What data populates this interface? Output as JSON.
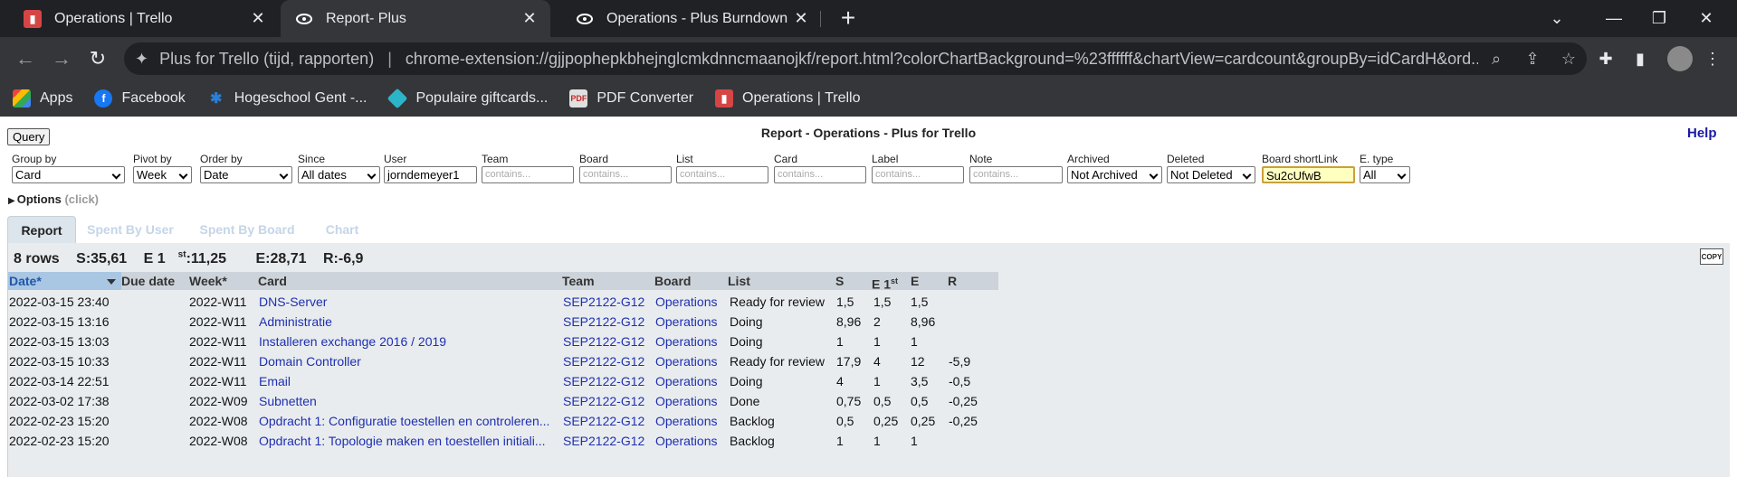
{
  "browser": {
    "tabs": [
      {
        "title": "Operations | Trello",
        "icon": "trello-icon",
        "active": false
      },
      {
        "title": "Report- Plus",
        "icon": "plus-for-trello-icon",
        "active": true
      },
      {
        "title": "Operations - Plus Burndown",
        "icon": "plus-for-trello-icon",
        "active": false
      }
    ],
    "address": {
      "site": "Plus for Trello (tijd, rapporten)",
      "separator": "|",
      "path": "chrome-extension://gjjpophepkbhejnglcmkdnncmaanojkf/report.html?colorChartBackground=%23ffffff&chartView=cardcount&groupBy=idCardH&ord..."
    },
    "bookmarks": [
      {
        "label": "Apps",
        "icon": "apps-grid-icon",
        "color": "#e8453c"
      },
      {
        "label": "Facebook",
        "icon": "facebook-icon",
        "color": "#1877f2"
      },
      {
        "label": "Hogeschool Gent -...",
        "icon": "hogent-icon",
        "color": "#2a7fd4"
      },
      {
        "label": "Populaire giftcards...",
        "icon": "giftcard-icon",
        "color": "#2bb5c8"
      },
      {
        "label": "PDF Converter",
        "icon": "pdf-icon",
        "color": "#e0e0e0"
      },
      {
        "label": "Operations | Trello",
        "icon": "trello-icon",
        "color": "#d64545"
      }
    ]
  },
  "report": {
    "query_label": "Query",
    "title": "Report - Operations - Plus for Trello",
    "help_label": "Help",
    "filters": {
      "group_by": {
        "label": "Group by",
        "value": "Card"
      },
      "pivot_by": {
        "label": "Pivot by",
        "value": "Week"
      },
      "order_by": {
        "label": "Order by",
        "value": "Date"
      },
      "since": {
        "label": "Since",
        "value": "All dates"
      },
      "user": {
        "label": "User",
        "value": "jorndemeyer1"
      },
      "team": {
        "label": "Team",
        "placeholder": "contains..."
      },
      "board": {
        "label": "Board",
        "placeholder": "contains..."
      },
      "list": {
        "label": "List",
        "placeholder": "contains..."
      },
      "card": {
        "label": "Card",
        "placeholder": "contains..."
      },
      "label": {
        "label": "Label",
        "placeholder": "contains..."
      },
      "note": {
        "label": "Note",
        "placeholder": "contains..."
      },
      "archived": {
        "label": "Archived",
        "value": "Not Archived"
      },
      "deleted": {
        "label": "Deleted",
        "value": "Not Deleted"
      },
      "board_shortlink": {
        "label": "Board shortLink",
        "value": "Su2cUfwB"
      },
      "e_type": {
        "label": "E. type",
        "value": "All"
      }
    },
    "options": {
      "label": "Options",
      "hint": "(click)"
    },
    "tabs": [
      "Report",
      "Spent By User",
      "Spent By Board",
      "Chart"
    ],
    "summary": {
      "rows": "8 rows",
      "s": "S:35,61",
      "e1_prefix": "E 1",
      "e1_sup": "st",
      "e1_value": ":11,25",
      "e": "E:28,71",
      "r": "R:-6,9"
    },
    "copy_label": "COPY",
    "columns": {
      "date": "Date*",
      "due": "Due date",
      "week": "Week*",
      "card": "Card",
      "team": "Team",
      "board": "Board",
      "list": "List",
      "s": "S",
      "e1": "E 1",
      "e1_sup": "st",
      "e": "E",
      "r": "R"
    },
    "rows": [
      {
        "date": "2022-03-15 23:40",
        "due": "",
        "week": "2022-W11",
        "card": "DNS-Server",
        "team": "SEP2122-G12",
        "board": "Operations",
        "list": "Ready for review",
        "s": "1,5",
        "e1": "1,5",
        "e": "1,5",
        "r": ""
      },
      {
        "date": "2022-03-15 13:16",
        "due": "",
        "week": "2022-W11",
        "card": "Administratie",
        "team": "SEP2122-G12",
        "board": "Operations",
        "list": "Doing",
        "s": "8,96",
        "e1": "2",
        "e": "8,96",
        "r": ""
      },
      {
        "date": "2022-03-15 13:03",
        "due": "",
        "week": "2022-W11",
        "card": "Installeren exchange 2016 / 2019",
        "team": "SEP2122-G12",
        "board": "Operations",
        "list": "Doing",
        "s": "1",
        "e1": "1",
        "e": "1",
        "r": ""
      },
      {
        "date": "2022-03-15 10:33",
        "due": "",
        "week": "2022-W11",
        "card": "Domain Controller",
        "team": "SEP2122-G12",
        "board": "Operations",
        "list": "Ready for review",
        "s": "17,9",
        "e1": "4",
        "e": "12",
        "r": "-5,9"
      },
      {
        "date": "2022-03-14 22:51",
        "due": "",
        "week": "2022-W11",
        "card": "Email",
        "team": "SEP2122-G12",
        "board": "Operations",
        "list": "Doing",
        "s": "4",
        "e1": "1",
        "e": "3,5",
        "r": "-0,5"
      },
      {
        "date": "2022-03-02 17:38",
        "due": "",
        "week": "2022-W09",
        "card": "Subnetten",
        "team": "SEP2122-G12",
        "board": "Operations",
        "list": "Done",
        "s": "0,75",
        "e1": "0,5",
        "e": "0,5",
        "r": "-0,25"
      },
      {
        "date": "2022-02-23 15:20",
        "due": "",
        "week": "2022-W08",
        "card": "Opdracht 1: Configuratie toestellen en controleren...",
        "team": "SEP2122-G12",
        "board": "Operations",
        "list": "Backlog",
        "s": "0,5",
        "e1": "0,25",
        "e": "0,25",
        "r": "-0,25"
      },
      {
        "date": "2022-02-23 15:20",
        "due": "",
        "week": "2022-W08",
        "card": "Opdracht 1: Topologie maken en toestellen initiali...",
        "team": "SEP2122-G12",
        "board": "Operations",
        "list": "Backlog",
        "s": "1",
        "e1": "1",
        "e": "1",
        "r": ""
      }
    ]
  }
}
